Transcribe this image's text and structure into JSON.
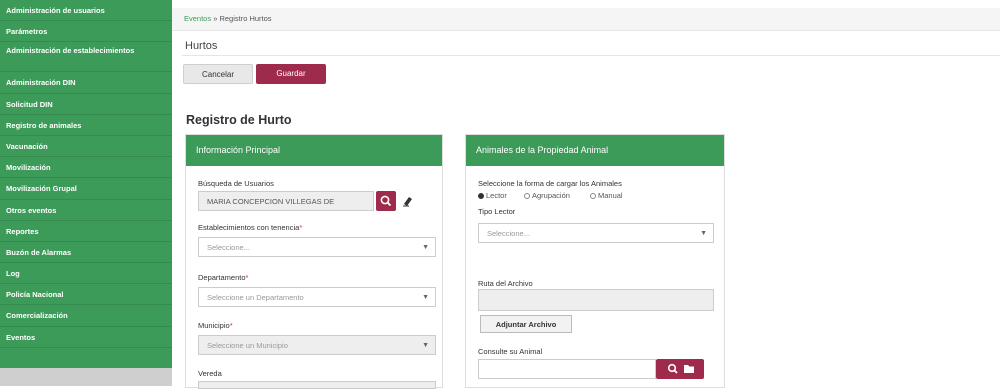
{
  "sidebar": {
    "items": [
      {
        "label": "Administración de usuarios",
        "tall": false
      },
      {
        "label": "Parámetros",
        "tall": false
      },
      {
        "label": "Administración de establecimientos",
        "tall": true
      },
      {
        "label": "Administración DIN",
        "tall": false
      },
      {
        "label": "Solicitud DIN",
        "tall": false
      },
      {
        "label": "Registro de animales",
        "tall": false
      },
      {
        "label": "Vacunación",
        "tall": false
      },
      {
        "label": "Movilización",
        "tall": false
      },
      {
        "label": "Movilización Grupal",
        "tall": false
      },
      {
        "label": "Otros eventos",
        "tall": false
      },
      {
        "label": "Reportes",
        "tall": false
      },
      {
        "label": "Buzón de Alarmas",
        "tall": false
      },
      {
        "label": "Log",
        "tall": false
      },
      {
        "label": "Policía Nacional",
        "tall": false
      },
      {
        "label": "Comercialización",
        "tall": false
      },
      {
        "label": "Eventos",
        "tall": false
      }
    ]
  },
  "breadcrumb": {
    "link": "Eventos",
    "separator": " » ",
    "current": "Registro Hurtos"
  },
  "page": {
    "title": "Hurtos",
    "form_heading": "Registro de Hurto"
  },
  "toolbar": {
    "cancel_label": "Cancelar",
    "save_label": "Guardar"
  },
  "left_panel": {
    "title": "Información Principal",
    "user_search": {
      "label": "Búsqueda de Usuarios",
      "value": "MARIA CONCEPCION VILLEGAS DE"
    },
    "establishments": {
      "label": "Establecimientos con tenencia",
      "required_mark": "*",
      "placeholder": "Seleccione..."
    },
    "department": {
      "label": "Departamento",
      "required_mark": "*",
      "placeholder": "Seleccione un Departamento"
    },
    "municipality": {
      "label": "Municipio",
      "required_mark": "*",
      "placeholder": "Seleccione un Municipio"
    },
    "vereda": {
      "label": "Vereda"
    }
  },
  "right_panel": {
    "title": "Animales de la Propiedad Animal",
    "load_prompt": "Seleccione la forma de cargar los Animales",
    "options": [
      "Lector",
      "Agrupación",
      "Manual"
    ],
    "selected_option": "Lector",
    "reader_type": {
      "label": "Tipo Lector",
      "placeholder": "Seleccione..."
    },
    "file_path": {
      "label": "Ruta del Archivo",
      "value": ""
    },
    "attach_label": "Adjuntar Archivo",
    "animal_query": {
      "label": "Consulte su Animal",
      "value": ""
    }
  },
  "colors": {
    "brand_green": "#3d9b5a",
    "accent_maroon": "#9e2b4b"
  },
  "icons": [
    "search-icon",
    "eraser-icon",
    "folder-icon",
    "caret-down-icon"
  ]
}
